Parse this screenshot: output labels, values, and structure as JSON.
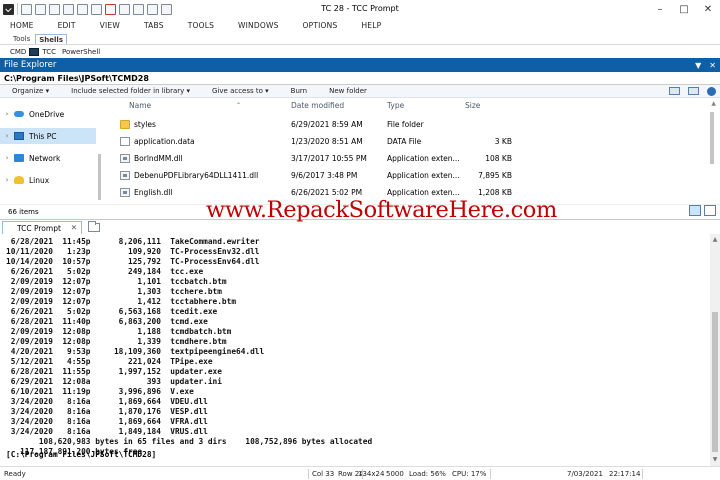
{
  "window": {
    "title": "TC 28 - TCC Prompt"
  },
  "menu": [
    "HOME",
    "EDIT",
    "VIEW",
    "TABS",
    "TOOLS",
    "WINDOWS",
    "OPTIONS",
    "HELP"
  ],
  "ribbon": {
    "tabs": [
      "Tools",
      "Shells"
    ],
    "active_tab": "Shells",
    "shells": [
      "CMD",
      "TCC",
      "PowerShell"
    ]
  },
  "explorer": {
    "title": "File Explorer",
    "path": "C:\\Program Files\\JPSoft\\TCMD28",
    "toolbar": [
      "Organize",
      "Include selected folder in library",
      "Give access to",
      "Burn",
      "New folder"
    ],
    "nav": [
      {
        "label": "OneDrive",
        "icon": "onedrive-icon"
      },
      {
        "label": "This PC",
        "icon": "computer-icon",
        "selected": true
      },
      {
        "label": "Network",
        "icon": "network-icon"
      },
      {
        "label": "Linux",
        "icon": "linux-icon"
      }
    ],
    "columns": {
      "name": "Name",
      "date": "Date modified",
      "type": "Type",
      "size": "Size"
    },
    "files": [
      {
        "name": "styles",
        "date": "6/29/2021 8:59 AM",
        "type": "File folder",
        "size": "",
        "kind": "folder"
      },
      {
        "name": "application.data",
        "date": "1/23/2020 8:51 AM",
        "type": "DATA File",
        "size": "3 KB",
        "kind": "file"
      },
      {
        "name": "BorlndMM.dll",
        "date": "3/17/2017 10:55 PM",
        "type": "Application exten...",
        "size": "108 KB",
        "kind": "dll"
      },
      {
        "name": "DebenuPDFLibrary64DLL1411.dll",
        "date": "9/6/2017 3:48 PM",
        "type": "Application exten...",
        "size": "7,895 KB",
        "kind": "dll"
      },
      {
        "name": "English.dll",
        "date": "6/26/2021 5:02 PM",
        "type": "Application exten...",
        "size": "1,208 KB",
        "kind": "dll"
      }
    ],
    "item_count": "66 items"
  },
  "watermark": "www.RepackSoftwareHere.com",
  "console": {
    "tab_label": "TCC Prompt",
    "lines": [
      " 6/28/2021  11:45p      8,206,111  TakeCommand.ewriter",
      "10/11/2020   1:23p        109,920  TC-ProcessEnv32.dll",
      "10/14/2020  10:57p        125,792  TC-ProcessEnv64.dll",
      " 6/26/2021   5:02p        249,184  tcc.exe",
      " 2/09/2019  12:07p          1,101  tccbatch.btm",
      " 2/09/2019  12:07p          1,303  tcchere.btm",
      " 2/09/2019  12:07p          1,412  tcctabhere.btm",
      " 6/26/2021   5:02p      6,563,168  tcedit.exe",
      " 6/28/2021  11:40p      6,863,200  tcmd.exe",
      " 2/09/2019  12:08p          1,188  tcmdbatch.btm",
      " 2/09/2019  12:08p          1,339  tcmdhere.btm",
      " 4/20/2021   9:53p     18,109,360  textpipeengine64.dll",
      " 5/12/2021   4:55p        221,024  TPipe.exe",
      " 6/28/2021  11:55p      1,997,152  updater.exe",
      " 6/29/2021  12:08a            393  updater.ini",
      " 6/10/2021  11:19p      3,996,896  V.exe",
      " 3/24/2020   8:16a      1,869,664  VDEU.dll",
      " 3/24/2020   8:16a      1,870,176  VESP.dll",
      " 3/24/2020   8:16a      1,869,664  VFRA.dll",
      " 3/24/2020   8:16a      1,849,184  VRUS.dll",
      "       108,620,983 bytes in 65 files and 3 dirs    108,752,896 bytes allocated",
      "   117,187,891,200 bytes free",
      "",
      "[C:\\Program Files\\JPSoft\\TCMD28]"
    ]
  },
  "statusbar": {
    "ready": "Ready",
    "col": "Col 33",
    "row": "Row 24",
    "size": "134x24",
    "buffer": "5000",
    "load": "Load: 56%",
    "cpu": "CPU: 17%",
    "date": "7/03/2021",
    "time": "22:17:14"
  }
}
